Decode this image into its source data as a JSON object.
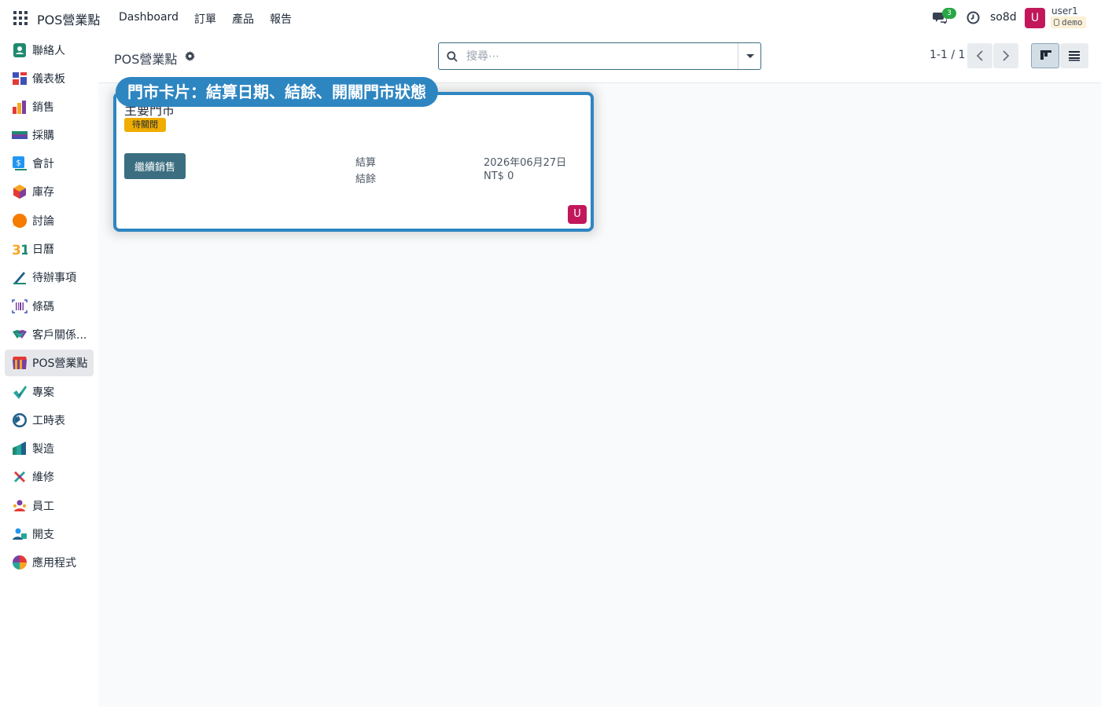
{
  "navbar": {
    "brand": "POS營業點",
    "menu": [
      "Dashboard",
      "訂單",
      "產品",
      "報告"
    ],
    "chat_count": "3",
    "company": "so8d",
    "avatar_letter": "U",
    "user_name": "user1",
    "database": "demo"
  },
  "sidebar": {
    "items": [
      {
        "label": "聯絡人",
        "icon": "contacts-icon"
      },
      {
        "label": "儀表板",
        "icon": "dashboard-icon"
      },
      {
        "label": "銷售",
        "icon": "sales-icon"
      },
      {
        "label": "採購",
        "icon": "purchase-icon"
      },
      {
        "label": "會計",
        "icon": "accounting-icon"
      },
      {
        "label": "庫存",
        "icon": "inventory-icon"
      },
      {
        "label": "討論",
        "icon": "discuss-icon"
      },
      {
        "label": "日曆",
        "icon": "calendar-icon"
      },
      {
        "label": "待辦事項",
        "icon": "todo-icon"
      },
      {
        "label": "條碼",
        "icon": "barcode-icon"
      },
      {
        "label": "客戶關係...",
        "icon": "crm-icon"
      },
      {
        "label": "POS營業點",
        "icon": "pos-icon",
        "active": true
      },
      {
        "label": "專案",
        "icon": "project-icon"
      },
      {
        "label": "工時表",
        "icon": "timesheet-icon"
      },
      {
        "label": "製造",
        "icon": "manufacturing-icon"
      },
      {
        "label": "維修",
        "icon": "repair-icon"
      },
      {
        "label": "員工",
        "icon": "employees-icon"
      },
      {
        "label": "開支",
        "icon": "expenses-icon"
      },
      {
        "label": "應用程式",
        "icon": "apps-icon"
      }
    ]
  },
  "control_panel": {
    "breadcrumb": "POS營業點",
    "search_placeholder": "搜尋⋯",
    "pager": "1-1 / 1"
  },
  "card": {
    "callout": "門市卡片：結算日期、結餘、開關門市狀態",
    "title": "主要門市",
    "status": "待關閉",
    "continue_label": "繼續銷售",
    "closing_label": "結算",
    "closing_value": "2026年06月27日",
    "balance_label": "結餘",
    "balance_value": "NT$ 0",
    "avatar_letter": "U"
  },
  "colors": {
    "accent": "#2e86c1",
    "primary": "#3b6e80",
    "status_badge": "#f0ad00",
    "avatar": "#c2185b"
  }
}
